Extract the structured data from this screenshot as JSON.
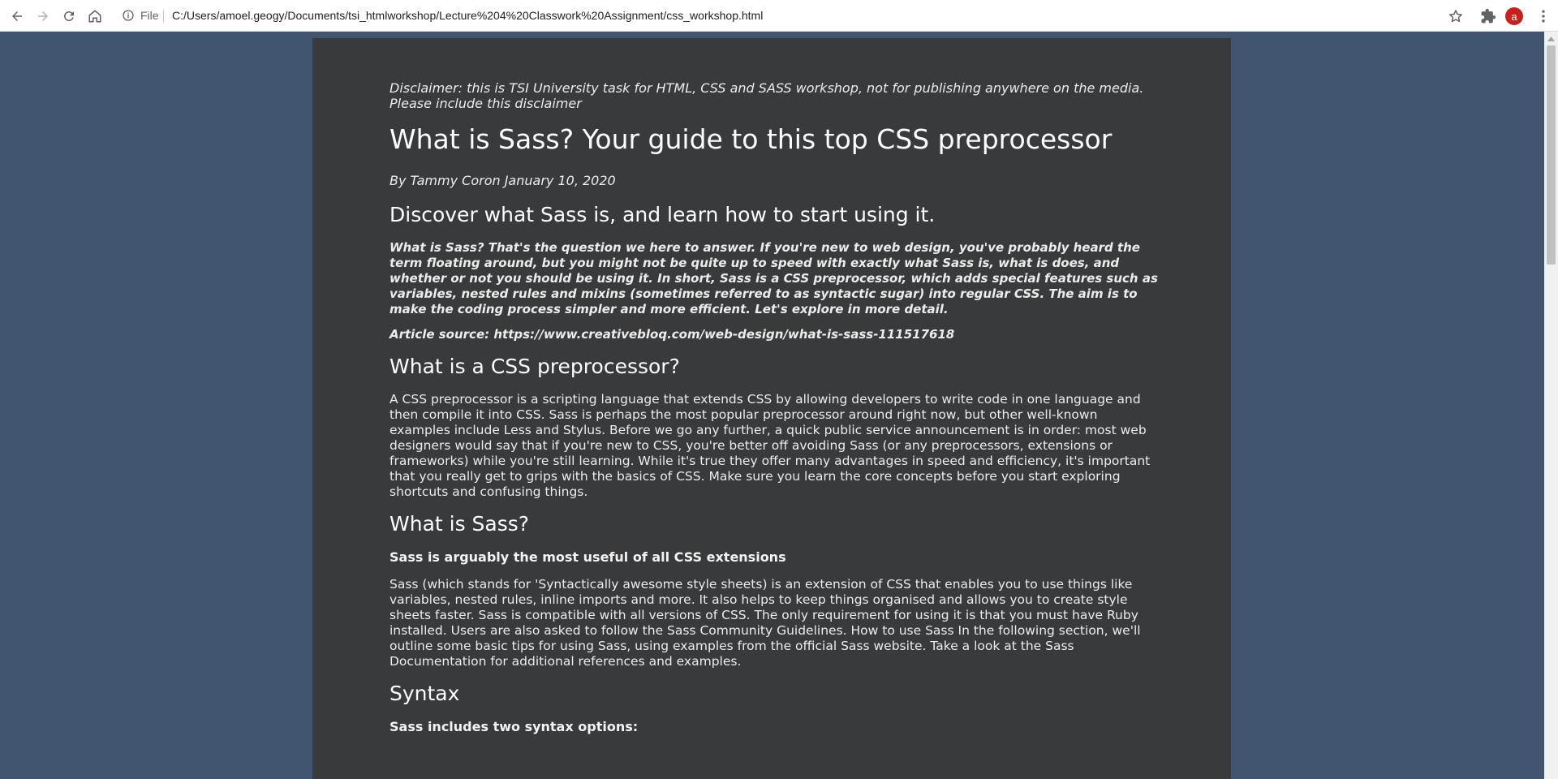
{
  "browser": {
    "file_label": "File",
    "url": "C:/Users/amoel.geogy/Documents/tsi_htmlworkshop/Lecture%204%20Classwork%20Assignment/css_workshop.html",
    "avatar_letter": "a",
    "icons": [
      "back-icon",
      "forward-icon",
      "reload-icon",
      "home-icon",
      "info-icon",
      "star-icon",
      "extensions-icon",
      "menu-icon"
    ]
  },
  "article": {
    "disclaimer": "Disclaimer: this is TSI University task for HTML, CSS and SASS workshop, not for publishing anywhere on the media. Please include this disclaimer",
    "title": "What is Sass? Your guide to this top CSS preprocessor",
    "byline": "By Tammy Coron January 10, 2020",
    "subtitle": "Discover what Sass is, and learn how to start using it.",
    "intro": "What is Sass? That's the question we here to answer. If you're new to web design, you've probably heard the term floating around, but you might not be quite up to speed with exactly what Sass is, what is does, and whether or not you should be using it. In short, Sass is a CSS preprocessor, which adds special features such as variables, nested rules and mixins (sometimes referred to as syntactic sugar) into regular CSS. The aim is to make the coding process simpler and more efficient. Let's explore in more detail.",
    "source": "Article source: https://www.creativebloq.com/web-design/what-is-sass-111517618",
    "section1_heading": "What is a CSS preprocessor?",
    "section1_text": "A CSS preprocessor is a scripting language that extends CSS by allowing developers to write code in one language and then compile it into CSS. Sass is perhaps the most popular preprocessor around right now, but other well-known examples include Less and Stylus. Before we go any further, a quick public service announcement is in order: most web designers would say that if you're new to CSS, you're better off avoiding Sass (or any preprocessors, extensions or frameworks) while you're still learning. While it's true they offer many advantages in speed and efficiency, it's important that you really get to grips with the basics of CSS. Make sure you learn the core concepts before you start exploring shortcuts and confusing things.",
    "section2_heading": "What is Sass?",
    "section2_subheading": "Sass is arguably the most useful of all CSS extensions",
    "section2_text": "Sass (which stands for 'Syntactically awesome style sheets) is an extension of CSS that enables you to use things like variables, nested rules, inline imports and more. It also helps to keep things organised and allows you to create style sheets faster. Sass is compatible with all versions of CSS. The only requirement for using it is that you must have Ruby installed. Users are also asked to follow the Sass Community Guidelines. How to use Sass In the following section, we'll outline some basic tips for using Sass, using examples from the official Sass website. Take a look at the Sass Documentation for additional references and examples.",
    "section3_heading": "Syntax",
    "section3_subheading": "Sass includes two syntax options:"
  },
  "colors": {
    "page_bg": "#425570",
    "panel_bg": "#393a3b",
    "text": "#ececec"
  }
}
